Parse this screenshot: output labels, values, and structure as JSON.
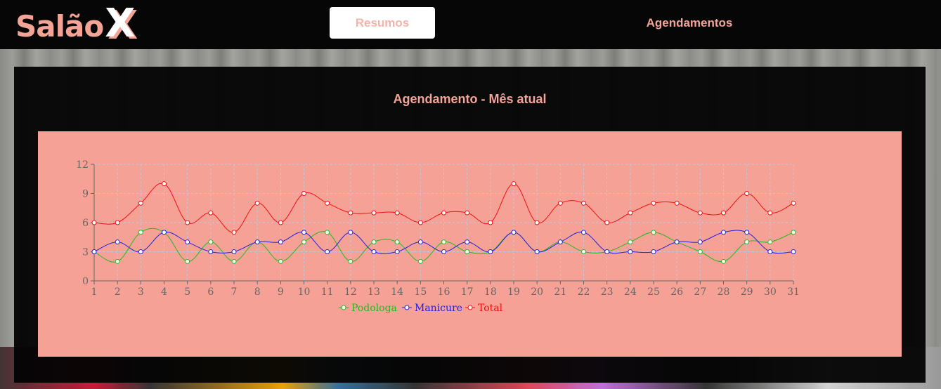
{
  "brand": {
    "name": "Salão",
    "mark": "X"
  },
  "nav": {
    "resumos": "Resumos",
    "agendamentos": "Agendamentos"
  },
  "panel": {
    "title": "Agendamento - Mês atual"
  },
  "colors": {
    "accent": "#f4a497",
    "podologa": "#22bb22",
    "manicure": "#2222dd",
    "total": "#ee1111"
  },
  "chart_data": {
    "type": "line",
    "x": [
      1,
      2,
      3,
      4,
      5,
      6,
      7,
      8,
      9,
      10,
      11,
      12,
      13,
      14,
      15,
      16,
      17,
      18,
      19,
      20,
      21,
      22,
      23,
      24,
      25,
      26,
      27,
      28,
      29,
      30,
      31
    ],
    "ylim": [
      0,
      12
    ],
    "yticks": [
      0,
      3,
      6,
      9,
      12
    ],
    "grid": true,
    "legend_position": "bottom",
    "series": [
      {
        "name": "Podologa",
        "color": "#22bb22",
        "values": [
          3,
          2,
          5,
          5,
          2,
          4,
          2,
          4,
          2,
          4,
          5,
          2,
          4,
          4,
          2,
          4,
          3,
          3,
          5,
          3,
          4,
          3,
          3,
          4,
          5,
          4,
          3,
          2,
          4,
          4,
          5
        ]
      },
      {
        "name": "Manicure",
        "color": "#2222dd",
        "values": [
          3,
          4,
          3,
          5,
          4,
          3,
          3,
          4,
          4,
          5,
          3,
          5,
          3,
          3,
          4,
          3,
          4,
          3,
          5,
          3,
          4,
          5,
          3,
          3,
          3,
          4,
          4,
          5,
          5,
          3,
          3
        ]
      },
      {
        "name": "Total",
        "color": "#ee1111",
        "values": [
          6,
          6,
          8,
          10,
          6,
          7,
          5,
          8,
          6,
          9,
          8,
          7,
          7,
          7,
          6,
          7,
          7,
          6,
          10,
          6,
          8,
          8,
          6,
          7,
          8,
          8,
          7,
          7,
          9,
          7,
          8
        ]
      }
    ]
  }
}
